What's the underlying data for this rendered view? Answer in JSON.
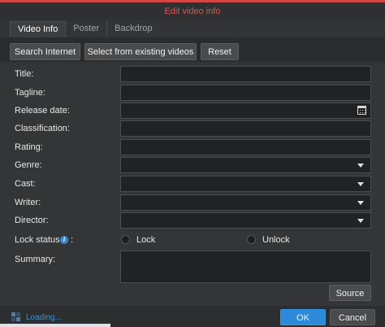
{
  "dialog": {
    "title": "Edit video info"
  },
  "tabs": [
    "Video Info",
    "Poster",
    "Backdrop"
  ],
  "toolbar": {
    "search_internet": "Search Internet",
    "select_existing": "Select from existing videos",
    "reset": "Reset"
  },
  "fields": {
    "title": "Title:",
    "tagline": "Tagline:",
    "release_date": "Release date:",
    "classification": "Classification:",
    "rating": "Rating:",
    "genre": "Genre:",
    "cast": "Cast:",
    "writer": "Writer:",
    "director": "Director:",
    "lock_status": "Lock status",
    "lock_colon": ":",
    "summary": "Summary:"
  },
  "lock": {
    "lock": "Lock",
    "unlock": "Unlock",
    "info_glyph": "i"
  },
  "buttons": {
    "source": "Source",
    "ok": "OK",
    "cancel": "Cancel"
  },
  "status": {
    "loading": "Loading..."
  },
  "colors": {
    "title_red": "#d9534f",
    "accent_blue": "#3b8ad8"
  }
}
